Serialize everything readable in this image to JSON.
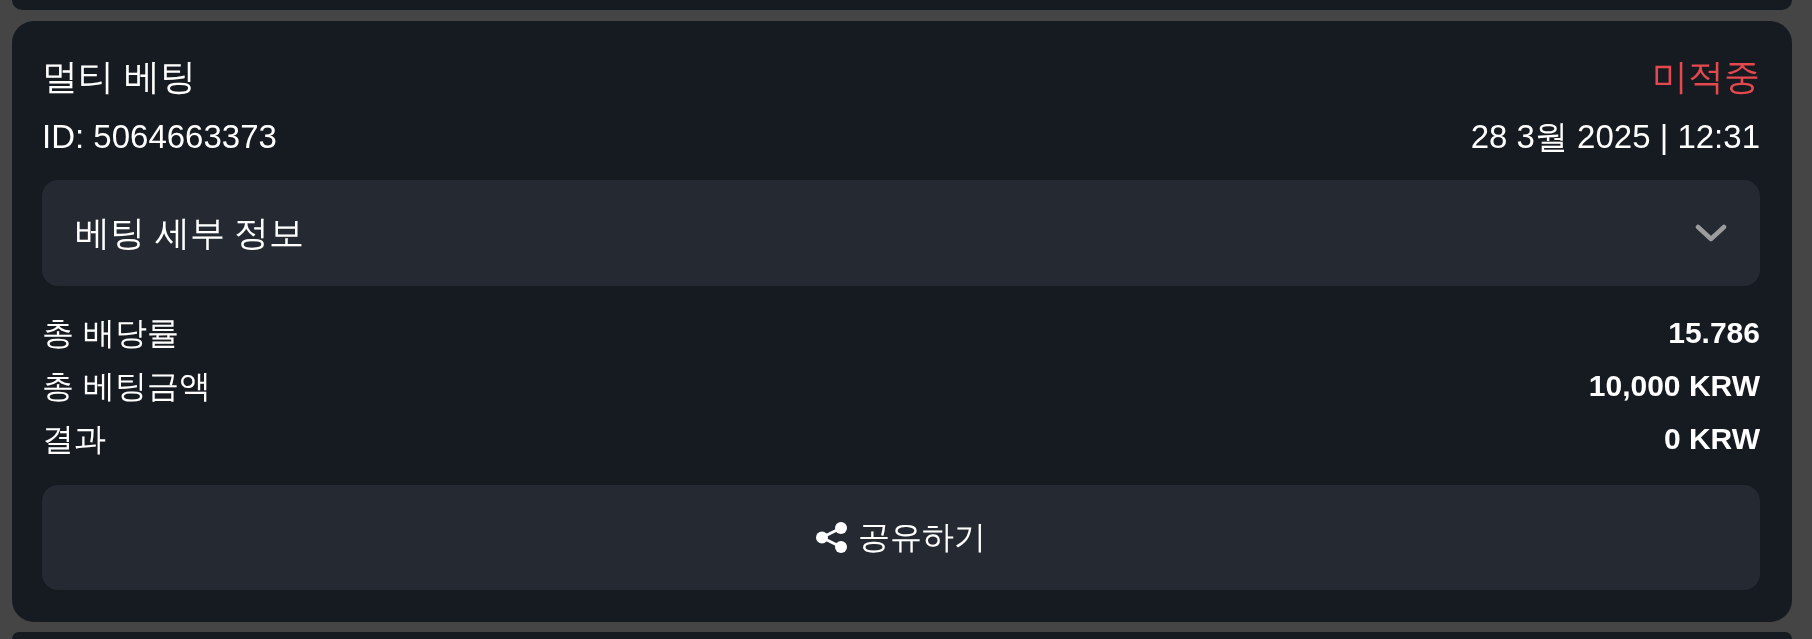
{
  "bet": {
    "title": "멀티 베팅",
    "status": {
      "label": "미적중",
      "kind": "lost"
    },
    "id": "ID: 5064663373",
    "datetime": "28 3월 2025 | 12:31"
  },
  "details": {
    "label": "베팅 세부 정보",
    "expanded": false
  },
  "summary": [
    {
      "label": "총 배당률",
      "value": "15.786"
    },
    {
      "label": "총 베팅금액",
      "value": "10,000 KRW"
    },
    {
      "label": "결과",
      "value": "0 KRW"
    }
  ],
  "share_button": {
    "label": "공유하기"
  }
}
